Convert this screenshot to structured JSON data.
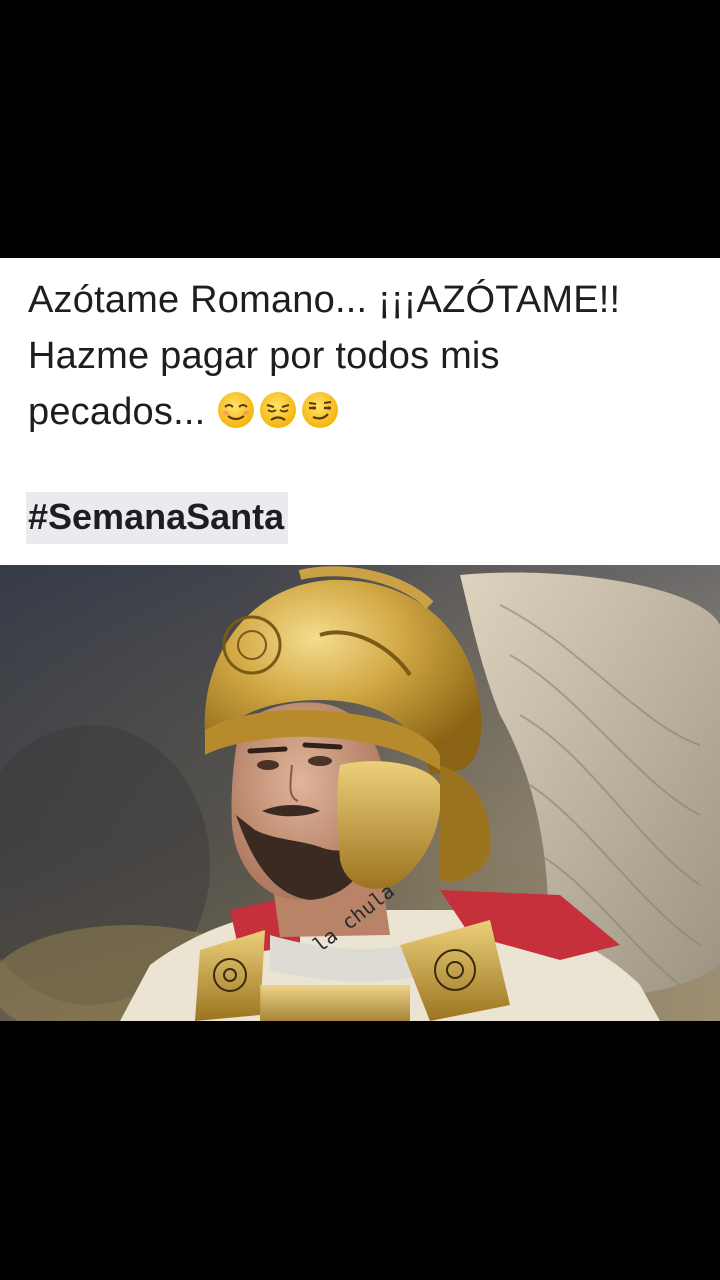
{
  "post": {
    "line1": "Azótame Romano... ¡¡¡AZÓTAME!!",
    "line2": "Hazme pagar por todos mis",
    "line3": "pecados...",
    "emojis": [
      "relieved-face",
      "disappointed-face",
      "smirking-face"
    ],
    "hashtag": "#SemanaSanta"
  },
  "photo": {
    "subject": "roman-soldier-gold-helmet",
    "watermark": "la chula"
  }
}
